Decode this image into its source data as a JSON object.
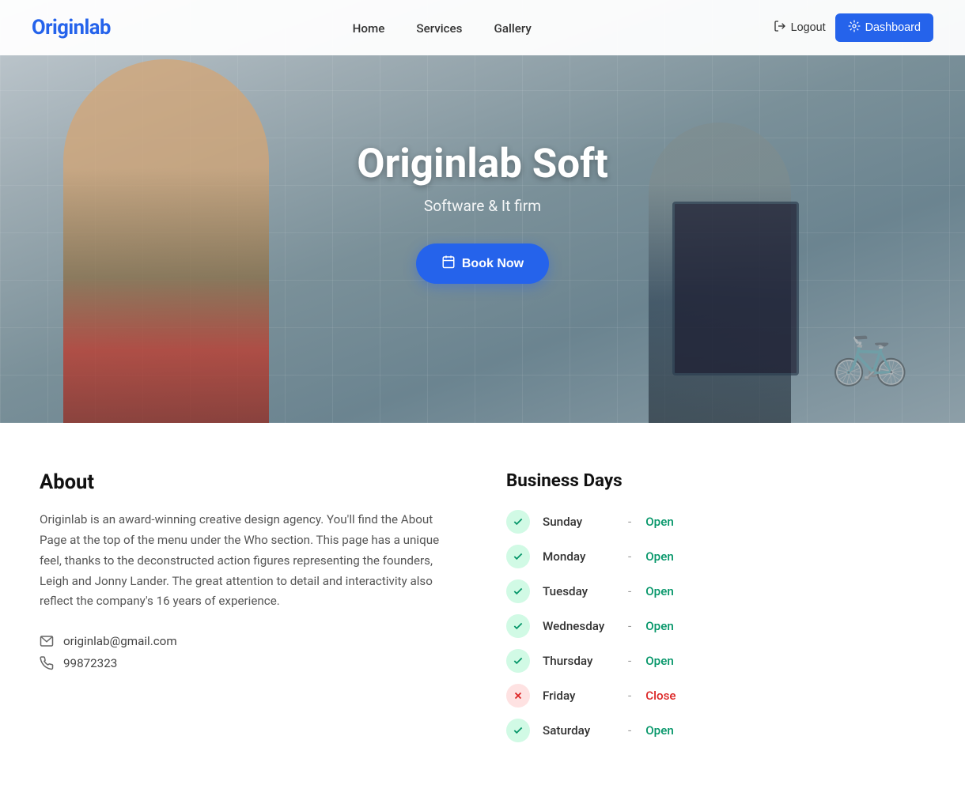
{
  "navbar": {
    "logo": "Originlab",
    "links": [
      {
        "label": "Home",
        "href": "#"
      },
      {
        "label": "Services",
        "href": "#"
      },
      {
        "label": "Gallery",
        "href": "#"
      }
    ],
    "logout_label": "Logout",
    "dashboard_label": "Dashboard"
  },
  "hero": {
    "title": "Originlab Soft",
    "subtitle": "Software & It firm",
    "book_button": "Book Now"
  },
  "about": {
    "title": "About",
    "text": "Originlab is an award-winning creative design agency. You'll find the About Page at the top of the menu under the Who section. This page has a unique feel, thanks to the deconstructed action figures representing the founders, Leigh and Jonny Lander. The great attention to detail and interactivity also reflect the company's 16 years of experience.",
    "email": "originlab@gmail.com",
    "phone": "99872323"
  },
  "business_days": {
    "title": "Business Days",
    "days": [
      {
        "name": "Sunday",
        "status": "Open",
        "open": true
      },
      {
        "name": "Monday",
        "status": "Open",
        "open": true
      },
      {
        "name": "Tuesday",
        "status": "Open",
        "open": true
      },
      {
        "name": "Wednesday",
        "status": "Open",
        "open": true
      },
      {
        "name": "Thursday",
        "status": "Open",
        "open": true
      },
      {
        "name": "Friday",
        "status": "Close",
        "open": false
      },
      {
        "name": "Saturday",
        "status": "Open",
        "open": true
      }
    ]
  }
}
